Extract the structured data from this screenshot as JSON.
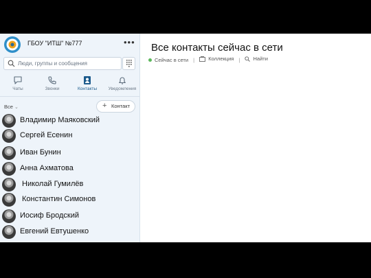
{
  "colors": {
    "sidebar_bg": "#eef4fa",
    "accent": "#1b5a8c",
    "online": "#5cb85c",
    "frame": "#000000"
  },
  "sidebar": {
    "org_name": "ГБОУ \"ИТШ\" №777",
    "more_label": "•••",
    "search": {
      "placeholder": "Люди, группы и сообщения",
      "icon": "search-icon",
      "dialpad_icon": "dialpad-icon"
    },
    "tabs": [
      {
        "label": "Чаты",
        "icon": "chat-icon",
        "active": false
      },
      {
        "label": "Звонки",
        "icon": "phone-icon",
        "active": false
      },
      {
        "label": "Контакты",
        "icon": "contacts-icon",
        "active": true
      },
      {
        "label": "Уведомления",
        "icon": "bell-icon",
        "active": false
      }
    ],
    "filter_label": "Все",
    "add_contact": {
      "plus": "+",
      "label": "Контакт"
    },
    "contacts": [
      "Владимир Маяковский",
      "Сергей Есенин",
      "Иван Бунин",
      "Анна Ахматова",
      "Николай Гумилёв",
      "Константин Симонов",
      "Иосиф Бродский",
      "Евгений Евтушенко"
    ]
  },
  "main": {
    "title": "Все контакты сейчас в сети",
    "links": [
      {
        "label": "Сейчас в сети",
        "icon": "online-dot-icon"
      },
      {
        "label": "Коллекция",
        "icon": "collection-icon"
      },
      {
        "label": "Найти",
        "icon": "search-icon"
      }
    ],
    "separator": "|"
  }
}
